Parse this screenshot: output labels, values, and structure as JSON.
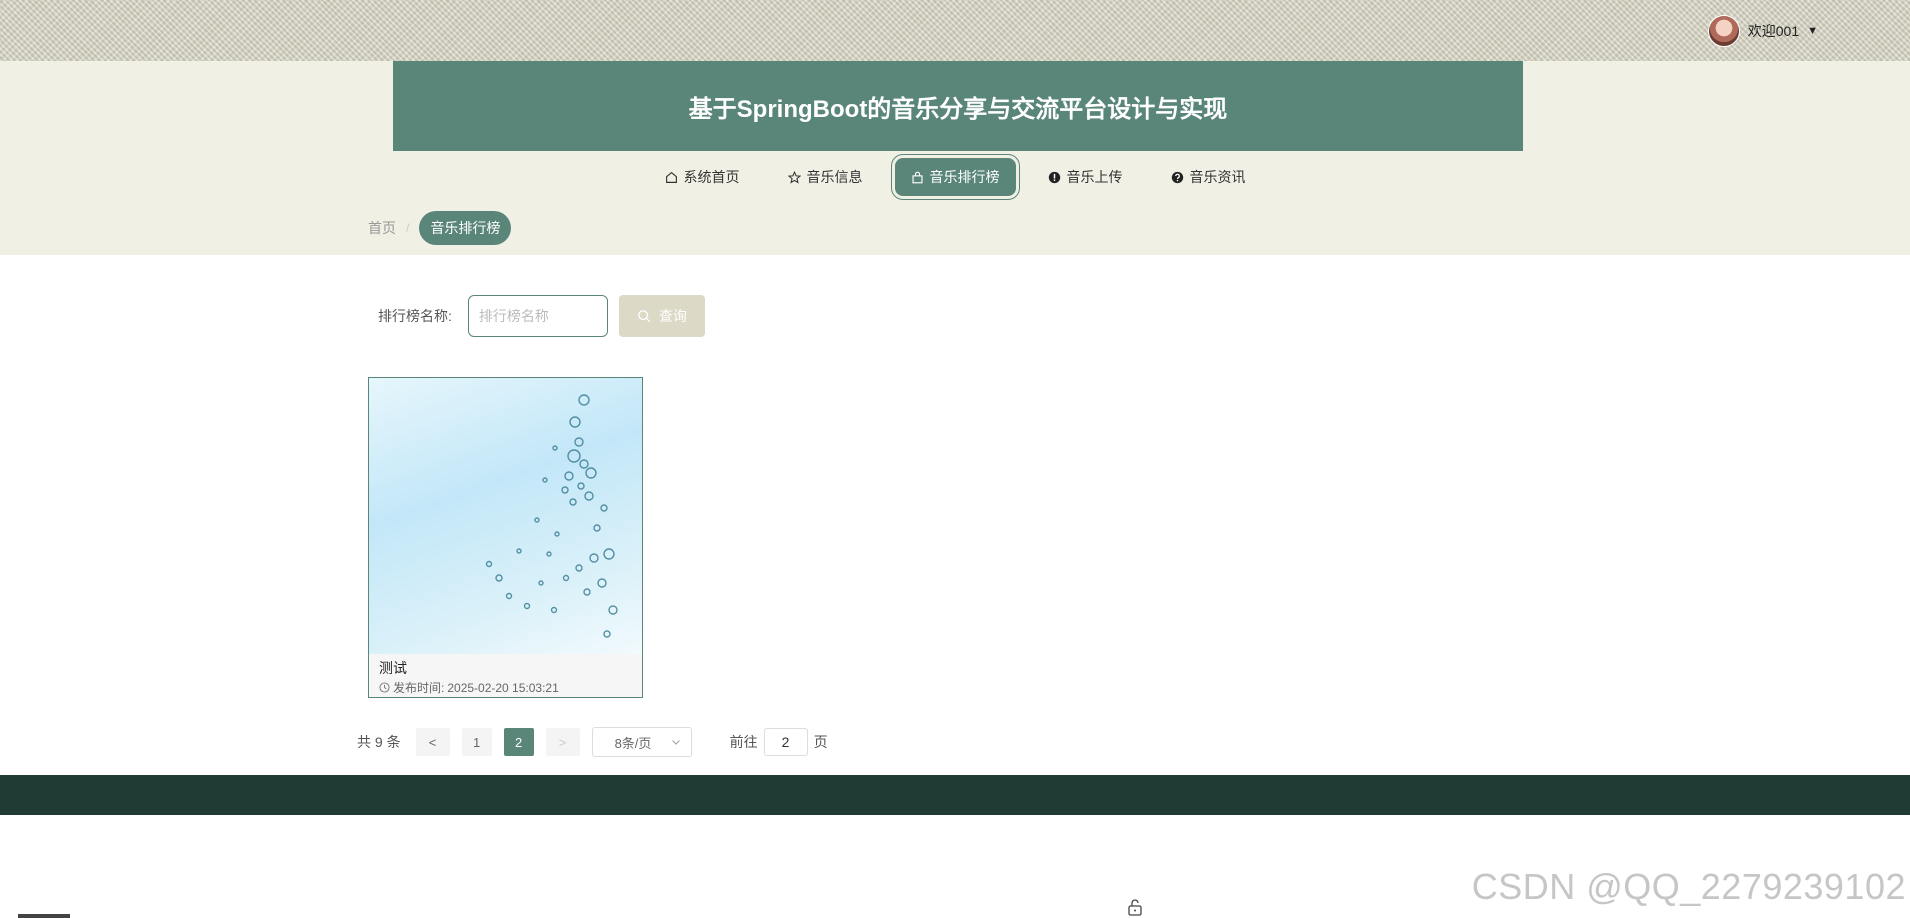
{
  "user": {
    "welcome": "欢迎001",
    "caret": "▼"
  },
  "header": {
    "title": "基于SpringBoot的音乐分享与交流平台设计与实现"
  },
  "nav": {
    "items": [
      {
        "label": "系统首页",
        "icon": "home-icon"
      },
      {
        "label": "音乐信息",
        "icon": "star-icon"
      },
      {
        "label": "音乐排行榜",
        "icon": "bag-icon",
        "active": true
      },
      {
        "label": "音乐上传",
        "icon": "alert-icon"
      },
      {
        "label": "音乐资讯",
        "icon": "question-icon"
      }
    ]
  },
  "breadcrumb": {
    "home": "首页",
    "separator": "/",
    "current": "音乐排行榜"
  },
  "search": {
    "label": "排行榜名称:",
    "placeholder": "排行榜名称",
    "button": "查询"
  },
  "cards": [
    {
      "title": "测试",
      "meta_label": "发布时间:",
      "time": "2025-02-20 15:03:21"
    }
  ],
  "pagination": {
    "total": "共 9 条",
    "prev": "<",
    "pages": [
      "1",
      "2"
    ],
    "current_page": "2",
    "next": ">",
    "page_size": "8条/页",
    "goto_label": "前往",
    "goto_value": "2",
    "goto_suffix": "页"
  },
  "watermark": "CSDN @QQ_2279239102",
  "colors": {
    "accent": "#5a867a",
    "footer": "#1f3b34",
    "band": "#f0f0e4",
    "search_button": "#dcd9c6"
  }
}
